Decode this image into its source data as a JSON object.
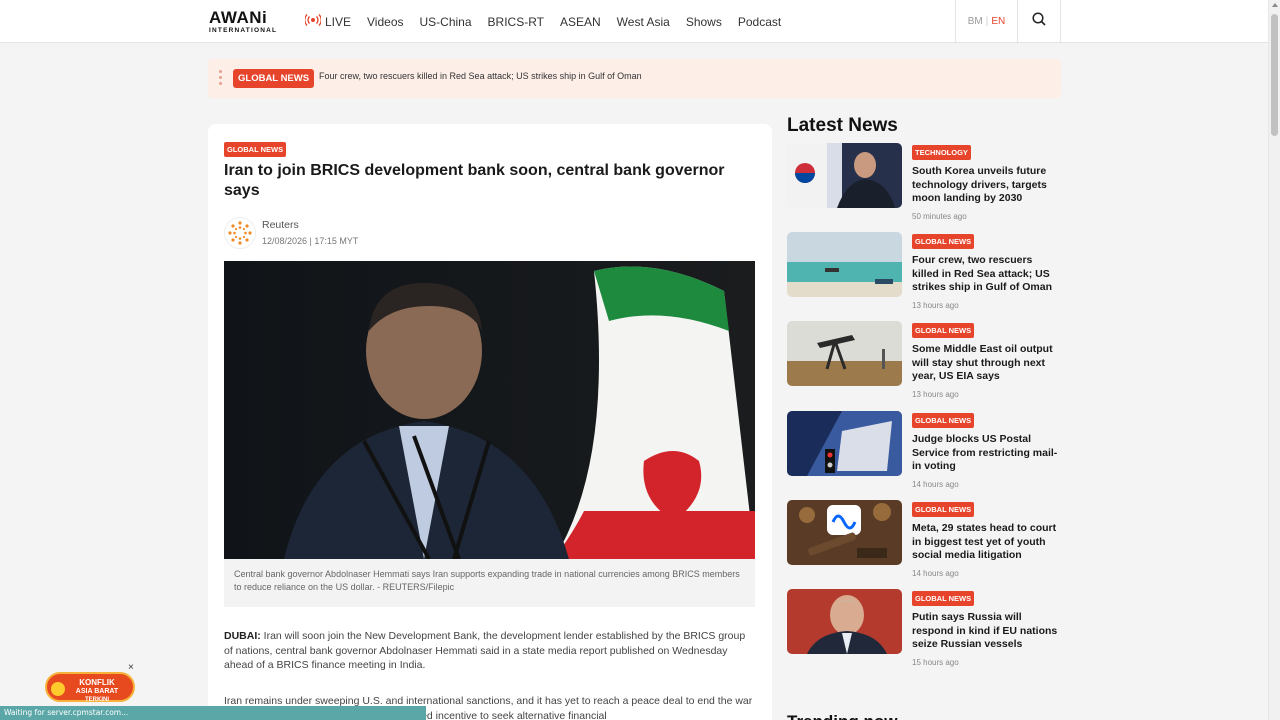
{
  "header": {
    "logo_main": "AWANi",
    "logo_sub": "INTERNATIONAL",
    "nav": [
      "LIVE",
      "Videos",
      "US-China",
      "BRICS-RT",
      "ASEAN",
      "West Asia",
      "Shows",
      "Podcast"
    ],
    "lang_bm": "BM",
    "lang_sep": "|",
    "lang_en": "EN",
    "accent": "#e6452b"
  },
  "ticker": {
    "badge": "GLOBAL NEWS",
    "text": "Four crew, two rescuers killed in Red Sea attack; US strikes ship in Gulf of Oman"
  },
  "article": {
    "category": "GLOBAL NEWS",
    "title": "Iran to join BRICS development bank soon, central bank governor says",
    "author": "Reuters",
    "date": "12/08/2026 | 17:15 MYT",
    "caption": "Central bank governor Abdolnaser Hemmati says Iran supports expanding trade in national currencies among BRICS members to reduce reliance on the US dollar. - REUTERS/Filepic",
    "p1_lead": "DUBAI:",
    "p1": " Iran will soon join the New Development Bank, the development lender established by the BRICS group of nations, central bank governor Abdolnaser Hemmati said in a state media report published on Wednesday ahead of a BRICS finance meeting in India.",
    "p2": "Iran remains under sweeping U.S. and international sanctions, and it has yet to reach a peace deal to end the war with the U.S. and Israel, giving Tehran added incentive to seek alternative financial"
  },
  "latest": {
    "title": "Latest News",
    "items": [
      {
        "category": "TECHNOLOGY",
        "headline": "South Korea unveils future technology drivers, targets moon landing by 2030",
        "time": "50 minutes ago"
      },
      {
        "category": "GLOBAL NEWS",
        "headline": "Four crew, two rescuers killed in Red Sea attack; US strikes ship in Gulf of Oman",
        "time": "13 hours ago"
      },
      {
        "category": "GLOBAL NEWS",
        "headline": "Some Middle East oil output will stay shut through next year, US EIA says",
        "time": "13 hours ago"
      },
      {
        "category": "GLOBAL NEWS",
        "headline": "Judge blocks US Postal Service from restricting mail-in voting",
        "time": "14 hours ago"
      },
      {
        "category": "GLOBAL NEWS",
        "headline": "Meta, 29 states head to court in biggest test yet of youth social media litigation",
        "time": "14 hours ago"
      },
      {
        "category": "GLOBAL NEWS",
        "headline": "Putin says Russia will respond in kind if EU nations seize Russian vessels",
        "time": "15 hours ago"
      }
    ]
  },
  "trending_title": "Trending now",
  "ad": {
    "line1": "KONFLIK",
    "line2": "ASIA BARAT",
    "line3": "TERKINI",
    "close": "×"
  },
  "status_text": "Waiting for server.cpmstar.com..."
}
